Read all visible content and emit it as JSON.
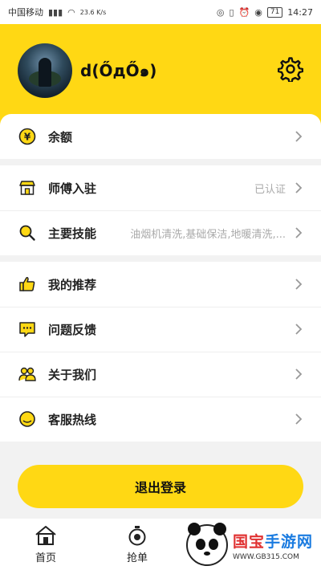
{
  "status_bar": {
    "carrier": "中国移动",
    "speed": "23.6 K/s",
    "battery": "71",
    "time": "14:27"
  },
  "profile": {
    "username": "d(ŐдŐ๑)"
  },
  "menu": {
    "balance": {
      "label": "余额"
    },
    "master": {
      "label": "师傅入驻",
      "value": "已认证"
    },
    "skills": {
      "label": "主要技能",
      "value": "油烟机清洗,基础保洁,地暖清洗,..."
    },
    "recommend": {
      "label": "我的推荐"
    },
    "feedback": {
      "label": "问题反馈"
    },
    "about": {
      "label": "关于我们"
    },
    "hotline": {
      "label": "客服热线"
    }
  },
  "logout_label": "退出登录",
  "tabs": [
    {
      "label": "首页",
      "icon": "home-icon"
    },
    {
      "label": "抢单",
      "icon": "stopwatch-icon"
    }
  ],
  "watermark": {
    "title_a": "国宝",
    "title_b": "手游网",
    "url": "WWW.GB315.COM"
  },
  "colors": {
    "accent": "#ffd814",
    "background": "#f2f2f2"
  }
}
